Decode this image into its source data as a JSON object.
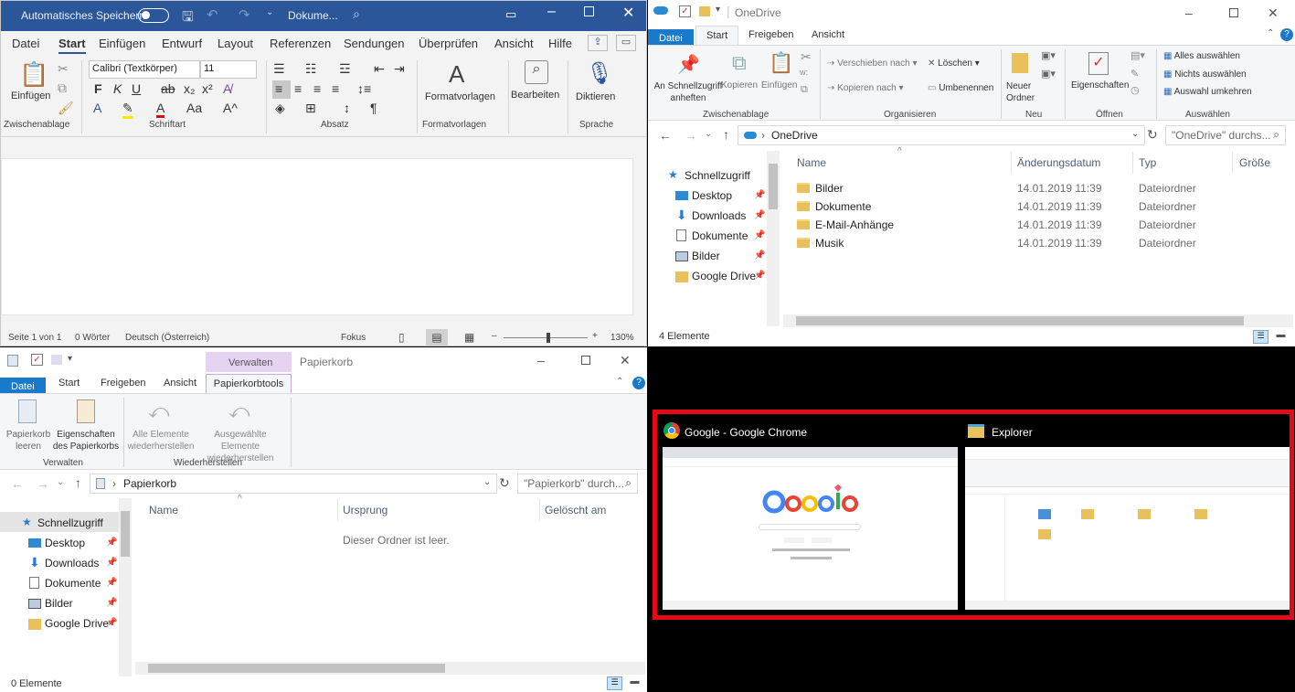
{
  "word": {
    "autosave_label": "Automatisches Speichern",
    "doc_title": "Dokume...",
    "tabs": [
      "Datei",
      "Start",
      "Einfügen",
      "Entwurf",
      "Layout",
      "Referenzen",
      "Sendungen",
      "Überprüfen",
      "Ansicht",
      "Hilfe"
    ],
    "active_tab": "Start",
    "font_name": "Calibri (Textkörper)",
    "font_size": "11",
    "groups": [
      "Zwischenablage",
      "Schriftart",
      "Absatz",
      "Formatvorlagen",
      "Sprache"
    ],
    "btn_paste": "Einfügen",
    "btn_styles": "Formatvorlagen",
    "btn_edit": "Bearbeiten",
    "btn_dictate": "Diktieren",
    "status": {
      "page": "Seite 1 von 1",
      "words": "0 Wörter",
      "lang": "Deutsch (Österreich)",
      "focus": "Fokus",
      "zoom": "130%"
    }
  },
  "onedrive": {
    "title": "OneDrive",
    "tabs": [
      "Datei",
      "Start",
      "Freigeben",
      "Ansicht"
    ],
    "ribbon": {
      "pin": "An Schnellzugriff anheften",
      "copy": "Kopieren",
      "paste": "Einfügen",
      "move": "Verschieben nach",
      "copyto": "Kopieren nach",
      "delete": "Löschen",
      "rename": "Umbenennen",
      "newfolder": "Neuer Ordner",
      "props": "Eigenschaften",
      "selall": "Alles auswählen",
      "selnone": "Nichts auswählen",
      "invert": "Auswahl umkehren",
      "groups": [
        "Zwischenablage",
        "Organisieren",
        "Neu",
        "Öffnen",
        "Auswählen"
      ]
    },
    "address": "OneDrive",
    "search_placeholder": "\"OneDrive\" durchs...",
    "nav": [
      "Schnellzugriff",
      "Desktop",
      "Downloads",
      "Dokumente",
      "Bilder",
      "Google Drive"
    ],
    "columns": [
      "Name",
      "Änderungsdatum",
      "Typ",
      "Größe"
    ],
    "rows": [
      {
        "name": "Bilder",
        "date": "14.01.2019 11:39",
        "type": "Dateiordner"
      },
      {
        "name": "Dokumente",
        "date": "14.01.2019 11:39",
        "type": "Dateiordner"
      },
      {
        "name": "E-Mail-Anhänge",
        "date": "14.01.2019 11:39",
        "type": "Dateiordner"
      },
      {
        "name": "Musik",
        "date": "14.01.2019 11:39",
        "type": "Dateiordner"
      }
    ],
    "count": "4 Elemente"
  },
  "bin": {
    "context_label": "Verwalten",
    "title": "Papierkorb",
    "tabs": [
      "Datei",
      "Start",
      "Freigeben",
      "Ansicht",
      "Papierkorbtools"
    ],
    "ribbon": {
      "empty": "Papierkorb leeren",
      "props": "Eigenschaften des Papierkorbs",
      "restore_all": "Alle Elemente wiederherstellen",
      "restore_sel": "Ausgewählte Elemente wiederherstellen",
      "groups": [
        "Verwalten",
        "Wiederherstellen"
      ]
    },
    "address": "Papierkorb",
    "search_placeholder": "\"Papierkorb\" durch...",
    "nav": [
      "Schnellzugriff",
      "Desktop",
      "Downloads",
      "Dokumente",
      "Bilder",
      "Google Drive"
    ],
    "columns": [
      "Name",
      "Ursprung",
      "Gelöscht am"
    ],
    "empty_msg": "Dieser Ordner ist leer.",
    "count": "0 Elemente"
  },
  "switcher": {
    "items": [
      {
        "label": "Google - Google Chrome",
        "icon": "chrome-icon"
      },
      {
        "label": "Explorer",
        "icon": "folder-icon"
      }
    ],
    "border_color": "#e30a17"
  }
}
